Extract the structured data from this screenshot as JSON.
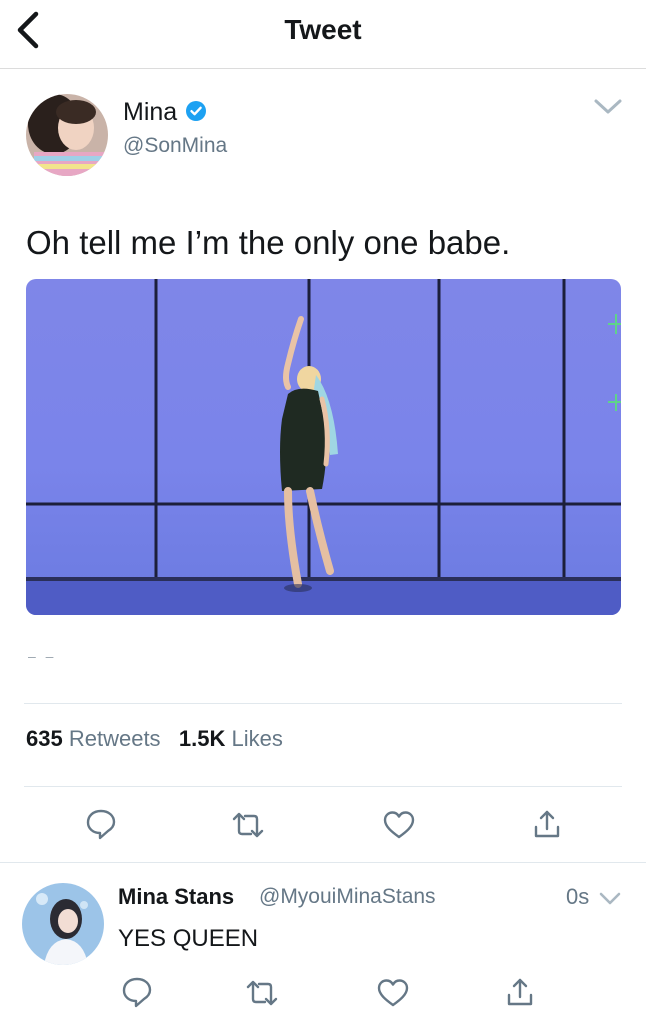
{
  "header": {
    "title": "Tweet"
  },
  "tweet": {
    "author_name": "Mina",
    "author_handle": "@SonMina",
    "text": "Oh tell me I’m the only one babe.",
    "ellipsis": "– –",
    "retweet_count": "635",
    "retweet_label": "Retweets",
    "like_count": "1.5K",
    "like_label": "Likes"
  },
  "reply": {
    "author_name": "Mina Stans",
    "author_handle": "@MyouiMinaStans",
    "time": "0s",
    "text": "YES QUEEN"
  },
  "icons": {
    "back": "chevron-left-icon",
    "verified": "verified-badge-icon",
    "menu": "chevron-down-icon",
    "reply": "reply-icon",
    "retweet": "retweet-icon",
    "like": "heart-icon",
    "share": "share-icon"
  },
  "colors": {
    "accent": "#1da1f2",
    "text": "#14171a",
    "muted": "#657786",
    "divider": "#e1e8ed",
    "icon": "#657786"
  }
}
